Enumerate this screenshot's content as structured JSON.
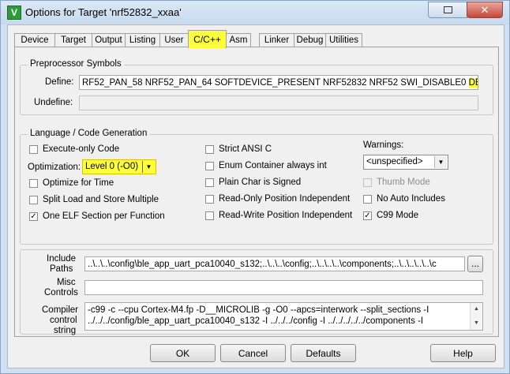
{
  "window": {
    "title": "Options for Target 'nrf52832_xxaa'",
    "app_icon": "V",
    "close_glyph": "✕"
  },
  "tabs": [
    "Device",
    "Target",
    "Output",
    "Listing",
    "User",
    "C/C++",
    "Asm",
    "Linker",
    "Debug",
    "Utilities"
  ],
  "preprocessor": {
    "title": "Preprocessor Symbols",
    "define_label": "Define:",
    "define_value": "RF52_PAN_58 NRF52_PAN_64 SOFTDEVICE_PRESENT NRF52832 NRF52 SWI_DISABLE0",
    "define_highlight": "DEBUG",
    "undefine_label": "Undefine:",
    "undefine_value": ""
  },
  "language": {
    "title": "Language / Code Generation",
    "execute_only": {
      "label": "Execute-only Code",
      "checked": false
    },
    "optimization_label": "Optimization:",
    "optimization_value": "Level 0 (-O0)",
    "optimize_time": {
      "label": "Optimize for Time",
      "checked": false
    },
    "split_load": {
      "label": "Split Load and Store Multiple",
      "checked": false
    },
    "one_elf": {
      "label": "One ELF Section per Function",
      "checked": true
    },
    "strict_ansi": {
      "label": "Strict ANSI C",
      "checked": false
    },
    "enum_container": {
      "label": "Enum Container always int",
      "checked": false
    },
    "plain_char": {
      "label": "Plain Char is Signed",
      "checked": false
    },
    "ro_pi": {
      "label": "Read-Only Position Independent",
      "checked": false
    },
    "rw_pi": {
      "label": "Read-Write Position Independent",
      "checked": false
    },
    "warnings_label": "Warnings:",
    "warnings_value": "<unspecified>",
    "thumb_mode": {
      "label": "Thumb Mode",
      "checked": false
    },
    "no_auto": {
      "label": "No Auto Includes",
      "checked": false
    },
    "c99": {
      "label": "C99 Mode",
      "checked": true
    }
  },
  "paths": {
    "include_label_1": "Include",
    "include_label_2": "Paths",
    "include_value": "..\\..\\..\\config\\ble_app_uart_pca10040_s132;..\\..\\..\\config;..\\..\\..\\..\\components;..\\..\\..\\..\\..\\c",
    "browse_label": "...",
    "misc_label_1": "Misc",
    "misc_label_2": "Controls",
    "misc_value": "",
    "compiler_label_1": "Compiler",
    "compiler_label_2": "control",
    "compiler_label_3": "string",
    "compiler_line_1": "-c99 -c --cpu Cortex-M4.fp -D__MICROLIB -g -O0 --apcs=interwork --split_sections -I",
    "compiler_line_2": "../../../config/ble_app_uart_pca10040_s132 -I ../../../config -I ../../../../../components -I"
  },
  "buttons": {
    "ok": "OK",
    "cancel": "Cancel",
    "defaults": "Defaults",
    "help": "Help"
  },
  "colors": {
    "highlight": "#ffff3a"
  }
}
